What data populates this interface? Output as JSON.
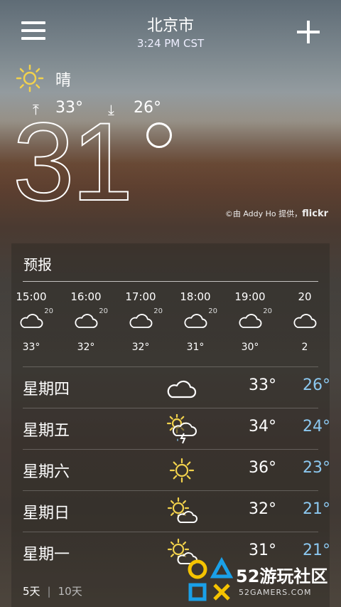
{
  "header": {
    "city": "北京市",
    "time": "3:24 PM CST"
  },
  "current": {
    "condition": "晴",
    "high": "33°",
    "low": "26°",
    "temp": "31",
    "condition_icon": "sunny-icon",
    "credit_prefix": "©由 Addy Ho 提供，",
    "credit_brand": "flickr"
  },
  "forecast": {
    "title": "预报",
    "hourly": [
      {
        "time": "15:00",
        "pct": "20",
        "temp": "33°",
        "icon": "cloudy-icon"
      },
      {
        "time": "16:00",
        "pct": "20",
        "temp": "32°",
        "icon": "cloudy-icon"
      },
      {
        "time": "17:00",
        "pct": "20",
        "temp": "32°",
        "icon": "cloudy-icon"
      },
      {
        "time": "18:00",
        "pct": "20",
        "temp": "31°",
        "icon": "cloudy-icon"
      },
      {
        "time": "19:00",
        "pct": "20",
        "temp": "30°",
        "icon": "cloudy-icon"
      },
      {
        "time": "20",
        "pct": "",
        "temp": "2",
        "icon": "cloudy-icon"
      }
    ],
    "daily": [
      {
        "day": "星期四",
        "hi": "33°",
        "lo": "26°",
        "icon": "cloudy-icon"
      },
      {
        "day": "星期五",
        "hi": "34°",
        "lo": "24°",
        "icon": "thunderstorm-icon"
      },
      {
        "day": "星期六",
        "hi": "36°",
        "lo": "23°",
        "icon": "sunny-icon"
      },
      {
        "day": "星期日",
        "hi": "32°",
        "lo": "21°",
        "icon": "partly-cloudy-icon"
      },
      {
        "day": "星期一",
        "hi": "31°",
        "lo": "21°",
        "icon": "partly-cloudy-icon"
      }
    ],
    "tabs": {
      "five": "5天",
      "ten": "10天"
    }
  },
  "watermark": {
    "brand": "52游玩社区",
    "sub": "52GAMERS.COM"
  },
  "colors": {
    "low_temp": "#8cc8f0",
    "sun": "#f2d24c"
  }
}
